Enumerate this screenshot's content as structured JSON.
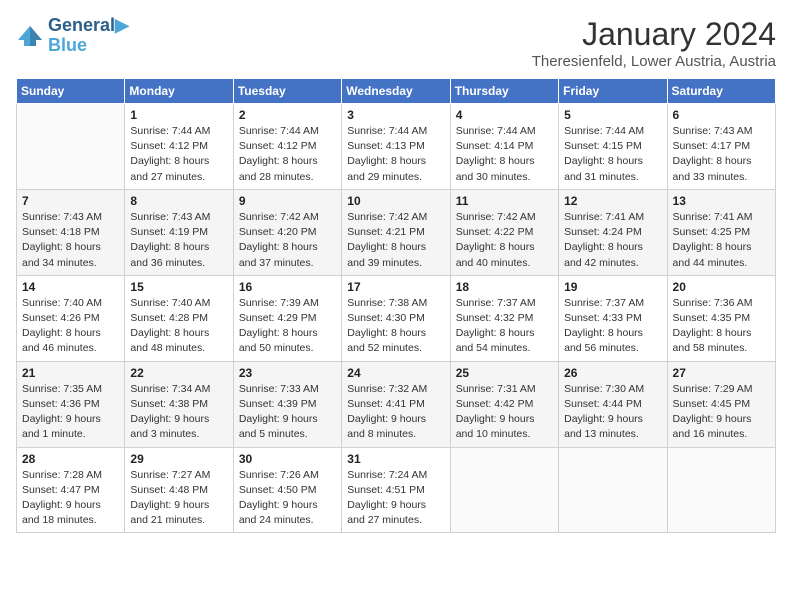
{
  "header": {
    "logo_line1": "General",
    "logo_line2": "Blue",
    "title": "January 2024",
    "subtitle": "Theresienfeld, Lower Austria, Austria"
  },
  "weekdays": [
    "Sunday",
    "Monday",
    "Tuesday",
    "Wednesday",
    "Thursday",
    "Friday",
    "Saturday"
  ],
  "weeks": [
    [
      {
        "day": "",
        "sunrise": "",
        "sunset": "",
        "daylight": ""
      },
      {
        "day": "1",
        "sunrise": "7:44 AM",
        "sunset": "4:12 PM",
        "daylight": "8 hours and 27 minutes."
      },
      {
        "day": "2",
        "sunrise": "7:44 AM",
        "sunset": "4:12 PM",
        "daylight": "8 hours and 28 minutes."
      },
      {
        "day": "3",
        "sunrise": "7:44 AM",
        "sunset": "4:13 PM",
        "daylight": "8 hours and 29 minutes."
      },
      {
        "day": "4",
        "sunrise": "7:44 AM",
        "sunset": "4:14 PM",
        "daylight": "8 hours and 30 minutes."
      },
      {
        "day": "5",
        "sunrise": "7:44 AM",
        "sunset": "4:15 PM",
        "daylight": "8 hours and 31 minutes."
      },
      {
        "day": "6",
        "sunrise": "7:43 AM",
        "sunset": "4:17 PM",
        "daylight": "8 hours and 33 minutes."
      }
    ],
    [
      {
        "day": "7",
        "sunrise": "7:43 AM",
        "sunset": "4:18 PM",
        "daylight": "8 hours and 34 minutes."
      },
      {
        "day": "8",
        "sunrise": "7:43 AM",
        "sunset": "4:19 PM",
        "daylight": "8 hours and 36 minutes."
      },
      {
        "day": "9",
        "sunrise": "7:42 AM",
        "sunset": "4:20 PM",
        "daylight": "8 hours and 37 minutes."
      },
      {
        "day": "10",
        "sunrise": "7:42 AM",
        "sunset": "4:21 PM",
        "daylight": "8 hours and 39 minutes."
      },
      {
        "day": "11",
        "sunrise": "7:42 AM",
        "sunset": "4:22 PM",
        "daylight": "8 hours and 40 minutes."
      },
      {
        "day": "12",
        "sunrise": "7:41 AM",
        "sunset": "4:24 PM",
        "daylight": "8 hours and 42 minutes."
      },
      {
        "day": "13",
        "sunrise": "7:41 AM",
        "sunset": "4:25 PM",
        "daylight": "8 hours and 44 minutes."
      }
    ],
    [
      {
        "day": "14",
        "sunrise": "7:40 AM",
        "sunset": "4:26 PM",
        "daylight": "8 hours and 46 minutes."
      },
      {
        "day": "15",
        "sunrise": "7:40 AM",
        "sunset": "4:28 PM",
        "daylight": "8 hours and 48 minutes."
      },
      {
        "day": "16",
        "sunrise": "7:39 AM",
        "sunset": "4:29 PM",
        "daylight": "8 hours and 50 minutes."
      },
      {
        "day": "17",
        "sunrise": "7:38 AM",
        "sunset": "4:30 PM",
        "daylight": "8 hours and 52 minutes."
      },
      {
        "day": "18",
        "sunrise": "7:37 AM",
        "sunset": "4:32 PM",
        "daylight": "8 hours and 54 minutes."
      },
      {
        "day": "19",
        "sunrise": "7:37 AM",
        "sunset": "4:33 PM",
        "daylight": "8 hours and 56 minutes."
      },
      {
        "day": "20",
        "sunrise": "7:36 AM",
        "sunset": "4:35 PM",
        "daylight": "8 hours and 58 minutes."
      }
    ],
    [
      {
        "day": "21",
        "sunrise": "7:35 AM",
        "sunset": "4:36 PM",
        "daylight": "9 hours and 1 minute."
      },
      {
        "day": "22",
        "sunrise": "7:34 AM",
        "sunset": "4:38 PM",
        "daylight": "9 hours and 3 minutes."
      },
      {
        "day": "23",
        "sunrise": "7:33 AM",
        "sunset": "4:39 PM",
        "daylight": "9 hours and 5 minutes."
      },
      {
        "day": "24",
        "sunrise": "7:32 AM",
        "sunset": "4:41 PM",
        "daylight": "9 hours and 8 minutes."
      },
      {
        "day": "25",
        "sunrise": "7:31 AM",
        "sunset": "4:42 PM",
        "daylight": "9 hours and 10 minutes."
      },
      {
        "day": "26",
        "sunrise": "7:30 AM",
        "sunset": "4:44 PM",
        "daylight": "9 hours and 13 minutes."
      },
      {
        "day": "27",
        "sunrise": "7:29 AM",
        "sunset": "4:45 PM",
        "daylight": "9 hours and 16 minutes."
      }
    ],
    [
      {
        "day": "28",
        "sunrise": "7:28 AM",
        "sunset": "4:47 PM",
        "daylight": "9 hours and 18 minutes."
      },
      {
        "day": "29",
        "sunrise": "7:27 AM",
        "sunset": "4:48 PM",
        "daylight": "9 hours and 21 minutes."
      },
      {
        "day": "30",
        "sunrise": "7:26 AM",
        "sunset": "4:50 PM",
        "daylight": "9 hours and 24 minutes."
      },
      {
        "day": "31",
        "sunrise": "7:24 AM",
        "sunset": "4:51 PM",
        "daylight": "9 hours and 27 minutes."
      },
      {
        "day": "",
        "sunrise": "",
        "sunset": "",
        "daylight": ""
      },
      {
        "day": "",
        "sunrise": "",
        "sunset": "",
        "daylight": ""
      },
      {
        "day": "",
        "sunrise": "",
        "sunset": "",
        "daylight": ""
      }
    ]
  ]
}
